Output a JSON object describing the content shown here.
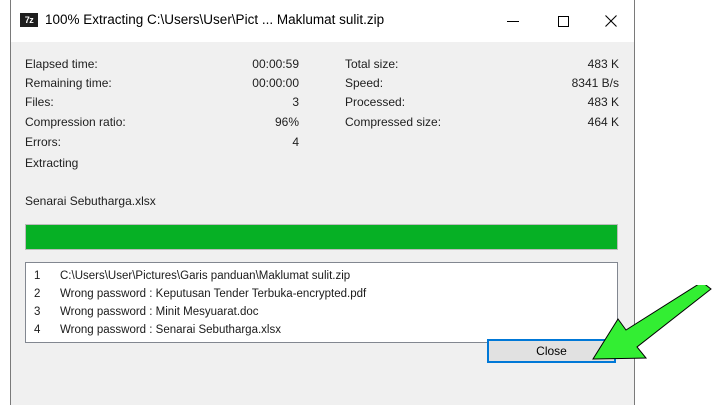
{
  "window": {
    "title": "100% Extracting C:\\Users\\User\\Pict ... Maklumat sulit.zip",
    "app_icon_text": "7z"
  },
  "stats_left": [
    {
      "label": "Elapsed time:",
      "value": "00:00:59"
    },
    {
      "label": "Remaining time:",
      "value": "00:00:00"
    },
    {
      "label": "Files:",
      "value": "3"
    },
    {
      "label": "Compression ratio:",
      "value": "96%"
    },
    {
      "label": "Errors:",
      "value": "4"
    }
  ],
  "stats_right": [
    {
      "label": "Total size:",
      "value": "483 K"
    },
    {
      "label": "Speed:",
      "value": "8341 B/s"
    },
    {
      "label": "Processed:",
      "value": "483 K"
    },
    {
      "label": "Compressed size:",
      "value": "464 K"
    }
  ],
  "status": {
    "operation": "Extracting",
    "current_file": "Senarai Sebutharga.xlsx"
  },
  "progress": {
    "fraction": 1.0,
    "color": "#06b025"
  },
  "log": [
    {
      "num": "1",
      "text": "C:\\Users\\User\\Pictures\\Garis panduan\\Maklumat sulit.zip"
    },
    {
      "num": "2",
      "text": "Wrong password : Keputusan Tender Terbuka-encrypted.pdf"
    },
    {
      "num": "3",
      "text": "Wrong password : Minit Mesyuarat.doc"
    },
    {
      "num": "4",
      "text": "Wrong password : Senarai Sebutharga.xlsx"
    }
  ],
  "buttons": {
    "close_label": "Close"
  },
  "annotation": {
    "icon": "green-arrow-icon",
    "color": "#33ee33"
  }
}
